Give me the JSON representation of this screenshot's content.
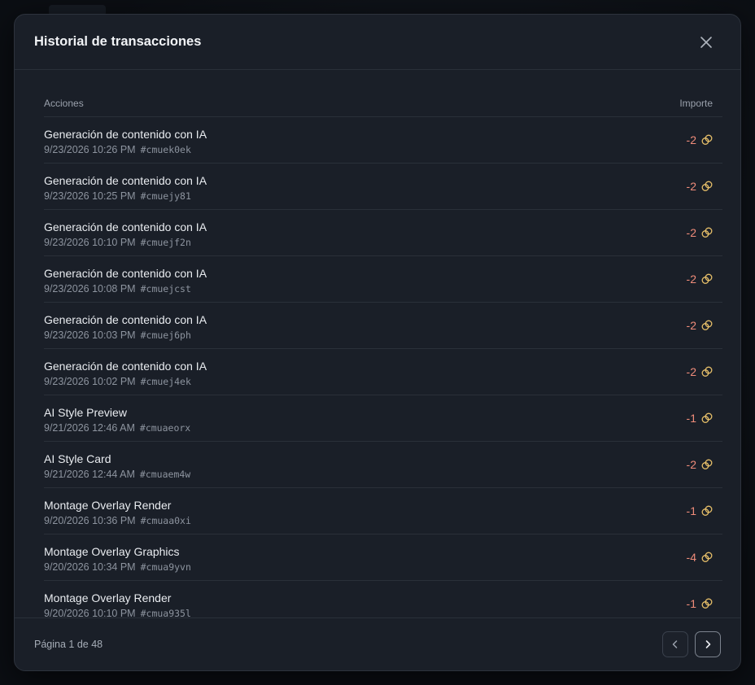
{
  "modal": {
    "title": "Historial de transacciones"
  },
  "table": {
    "col_actions": "Acciones",
    "col_amount": "Importe",
    "rows": [
      {
        "title": "Generación de contenido con IA",
        "datetime": "9/23/2026 10:26 PM",
        "id": "#cmuek0ek",
        "amount": "-2"
      },
      {
        "title": "Generación de contenido con IA",
        "datetime": "9/23/2026 10:25 PM",
        "id": "#cmuejy81",
        "amount": "-2"
      },
      {
        "title": "Generación de contenido con IA",
        "datetime": "9/23/2026 10:10 PM",
        "id": "#cmuejf2n",
        "amount": "-2"
      },
      {
        "title": "Generación de contenido con IA",
        "datetime": "9/23/2026 10:08 PM",
        "id": "#cmuejcst",
        "amount": "-2"
      },
      {
        "title": "Generación de contenido con IA",
        "datetime": "9/23/2026 10:03 PM",
        "id": "#cmuej6ph",
        "amount": "-2"
      },
      {
        "title": "Generación de contenido con IA",
        "datetime": "9/23/2026 10:02 PM",
        "id": "#cmuej4ek",
        "amount": "-2"
      },
      {
        "title": "AI Style Preview",
        "datetime": "9/21/2026 12:46 AM",
        "id": "#cmuaeorx",
        "amount": "-1"
      },
      {
        "title": "AI Style Card",
        "datetime": "9/21/2026 12:44 AM",
        "id": "#cmuaem4w",
        "amount": "-2"
      },
      {
        "title": "Montage Overlay Render",
        "datetime": "9/20/2026 10:36 PM",
        "id": "#cmuaa0xi",
        "amount": "-1"
      },
      {
        "title": "Montage Overlay Graphics",
        "datetime": "9/20/2026 10:34 PM",
        "id": "#cmua9yvn",
        "amount": "-4"
      },
      {
        "title": "Montage Overlay Render",
        "datetime": "9/20/2026 10:10 PM",
        "id": "#cmua935l",
        "amount": "-1"
      }
    ]
  },
  "footer": {
    "page_info": "Página 1 de 48"
  },
  "icons": {
    "close": "close-icon",
    "coin": "coins-icon",
    "prev": "chevron-left-icon",
    "next": "chevron-right-icon"
  },
  "colors": {
    "amount": "#f08c7a",
    "coin": "#e8c06a"
  }
}
